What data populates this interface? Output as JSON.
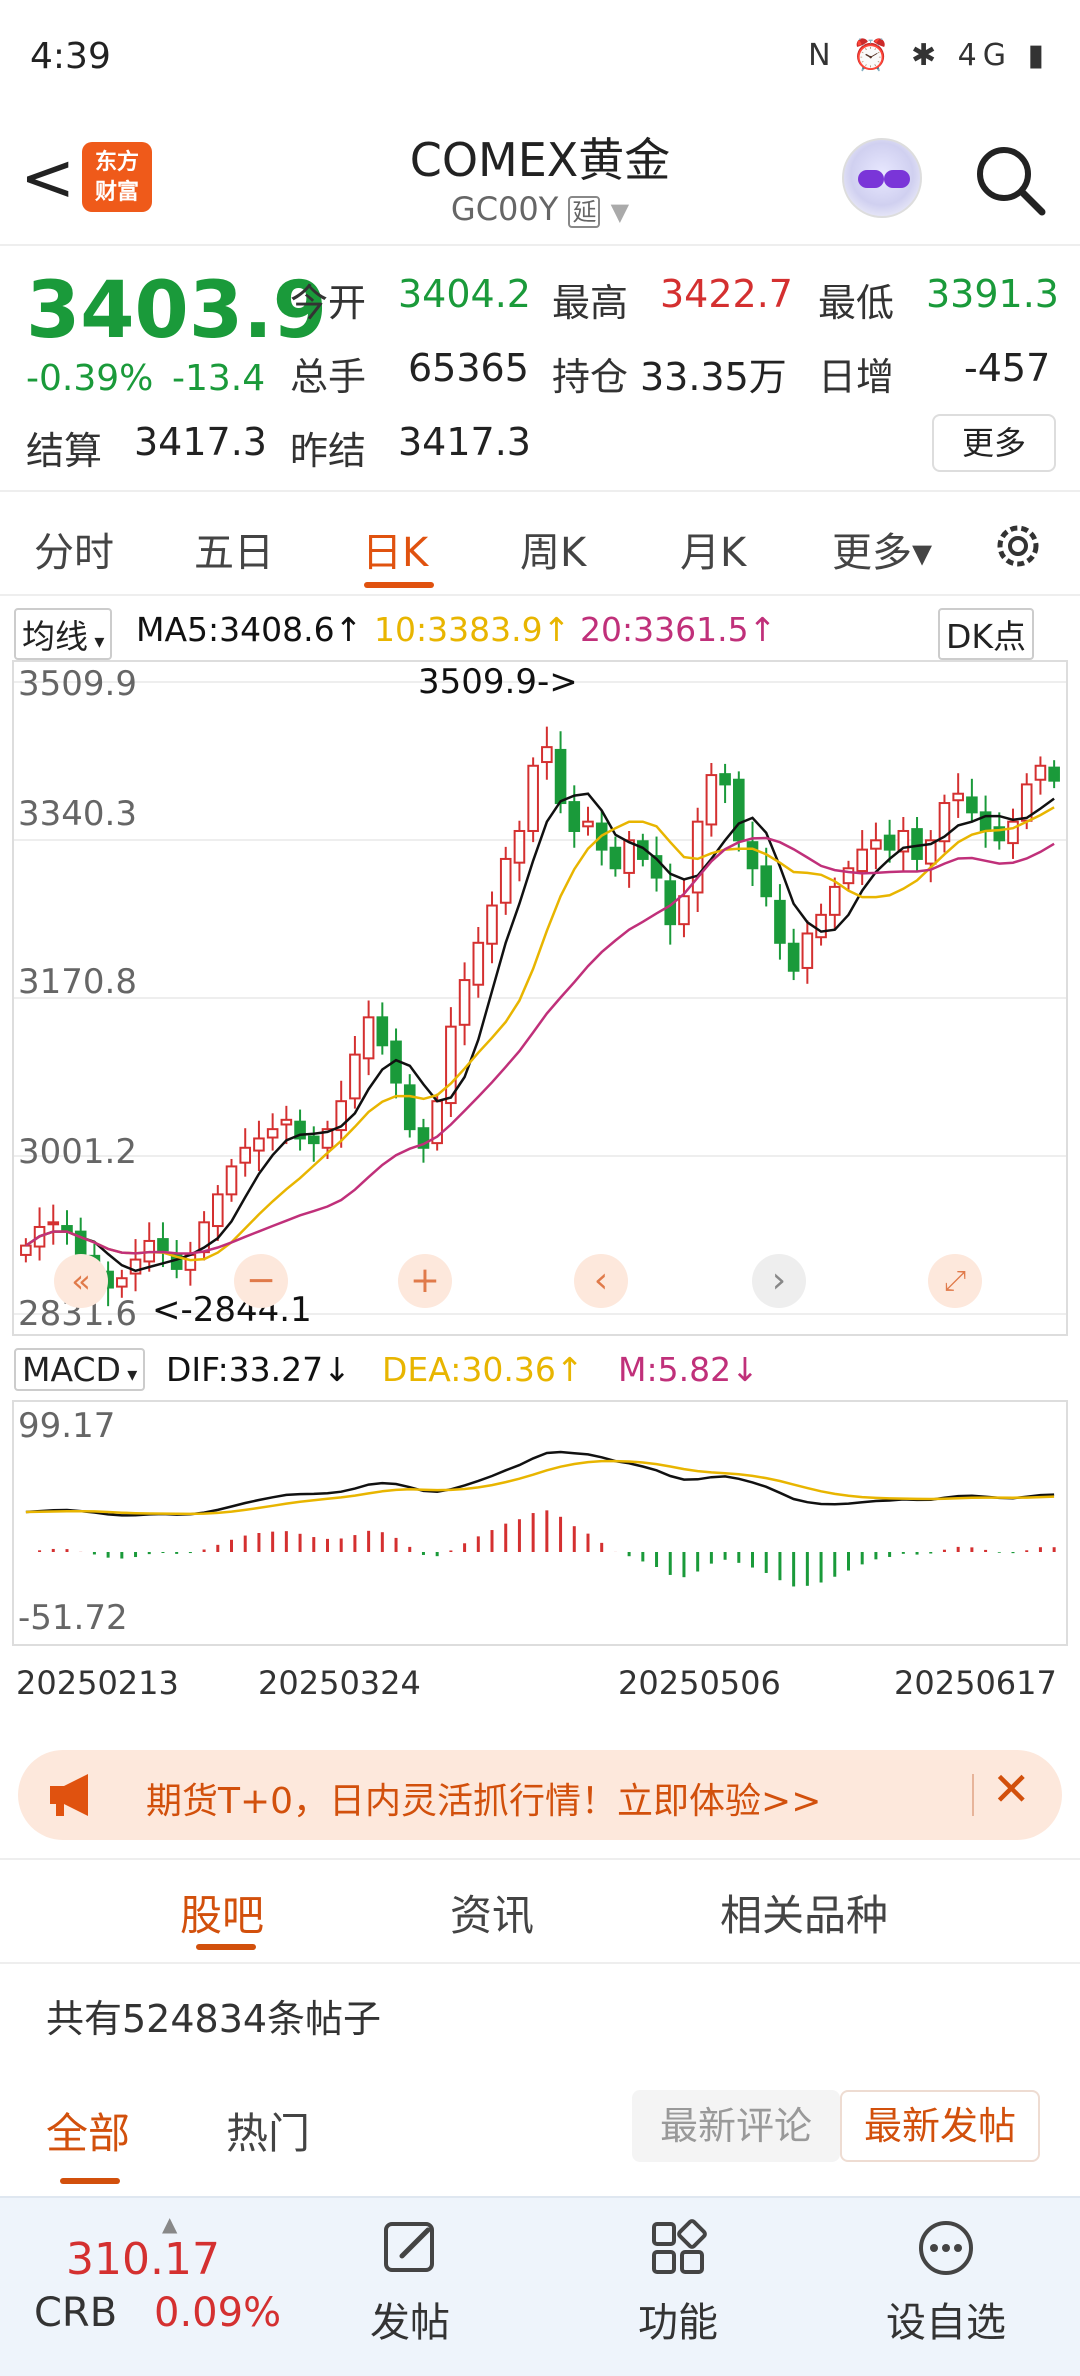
{
  "status": {
    "time": "4:39",
    "icons_text": "N ⏰ ✱ 4G ▮"
  },
  "header": {
    "back_label": "<",
    "logo_text_line1": "东方",
    "logo_text_line2": "财富",
    "title": "COMEX黄金",
    "code": "GC00Y",
    "code_badge": "延"
  },
  "quote": {
    "price": "3403.9",
    "change_pct": "-0.39%",
    "change_abs": "-13.4",
    "open_label": "今开",
    "open_value": "3404.2",
    "high_label": "最高",
    "high_value": "3422.7",
    "low_label": "最低",
    "low_value": "3391.3",
    "volume_label": "总手",
    "volume_value": "65365",
    "oi_label": "持仓",
    "oi_value": "33.35万",
    "daily_inc_label": "日增",
    "daily_inc_value": "-457",
    "settle_label": "结算",
    "settle_value": "3417.3",
    "prev_settle_label": "昨结",
    "prev_settle_value": "3417.3",
    "more_label": "更多"
  },
  "tabs": [
    {
      "label": "分时"
    },
    {
      "label": "五日"
    },
    {
      "label": "日K"
    },
    {
      "label": "周K"
    },
    {
      "label": "月K"
    },
    {
      "label": "更多▾"
    }
  ],
  "ma": {
    "selector": "均线",
    "ma5": "MA5:3408.6↑",
    "ma10": "10:3383.9↑",
    "ma20": "20:3361.5↑",
    "dk": "DK点"
  },
  "chart_axis": {
    "y_labels": [
      "3509.9",
      "3340.3",
      "3170.8",
      "3001.2",
      "2831.6"
    ],
    "max_marker": "3509.9->",
    "min_marker": "<-2844.1"
  },
  "macd": {
    "selector": "MACD",
    "dif": "DIF:33.27↓",
    "dea": "DEA:30.36↑",
    "m": "M:5.82↓",
    "y_top": "99.17",
    "y_bottom": "-51.72"
  },
  "dates": [
    "20250213",
    "20250324",
    "20250506",
    "20250617"
  ],
  "banner": {
    "text": "期货T+0，日内灵活抓行情！立即体验>>"
  },
  "section_tabs": [
    {
      "label": "股吧"
    },
    {
      "label": "资讯"
    },
    {
      "label": "相关品种"
    }
  ],
  "posts_count": "共有524834条帖子",
  "filters": {
    "all": "全部",
    "hot": "热门",
    "latest_comment": "最新评论",
    "latest_post": "最新发帖"
  },
  "bottom_nav": {
    "crb_value": "310.17",
    "crb_label": "CRB",
    "crb_change": "0.09%",
    "post": "发帖",
    "func": "功能",
    "watchlist": "设自选"
  },
  "colors": {
    "up": "#d43030",
    "down": "#1a9a3a",
    "accent": "#e0520f",
    "ma5": "#111111",
    "ma10": "#e8b500",
    "ma20": "#c0307a"
  },
  "chart_data": {
    "type": "candlestick",
    "categories": [
      "20250213",
      "20250324",
      "20250506",
      "20250617"
    ],
    "ylim": [
      2831.6,
      3509.9
    ],
    "y_ticks": [
      3509.9,
      3340.3,
      3170.8,
      3001.2,
      2831.6
    ],
    "series": [
      {
        "name": "MA5",
        "last": 3408.6
      },
      {
        "name": "10",
        "last": 3383.9
      },
      {
        "name": "20",
        "last": 3361.5
      }
    ],
    "close": [
      2905,
      2925,
      2930,
      2920,
      2890,
      2880,
      2860,
      2870,
      2890,
      2910,
      2900,
      2880,
      2895,
      2930,
      2960,
      2990,
      3010,
      3020,
      3030,
      3040,
      3020,
      3015,
      3030,
      3060,
      3110,
      3150,
      3120,
      3080,
      3030,
      3010,
      3060,
      3140,
      3190,
      3230,
      3270,
      3320,
      3350,
      3420,
      3440,
      3380,
      3350,
      3360,
      3330,
      3310,
      3340,
      3320,
      3300,
      3250,
      3280,
      3360,
      3410,
      3400,
      3340,
      3310,
      3280,
      3230,
      3200,
      3240,
      3260,
      3290,
      3310,
      3330,
      3340,
      3330,
      3350,
      3320,
      3340,
      3380,
      3390,
      3370,
      3350,
      3340,
      3360,
      3400,
      3420,
      3404
    ]
  }
}
